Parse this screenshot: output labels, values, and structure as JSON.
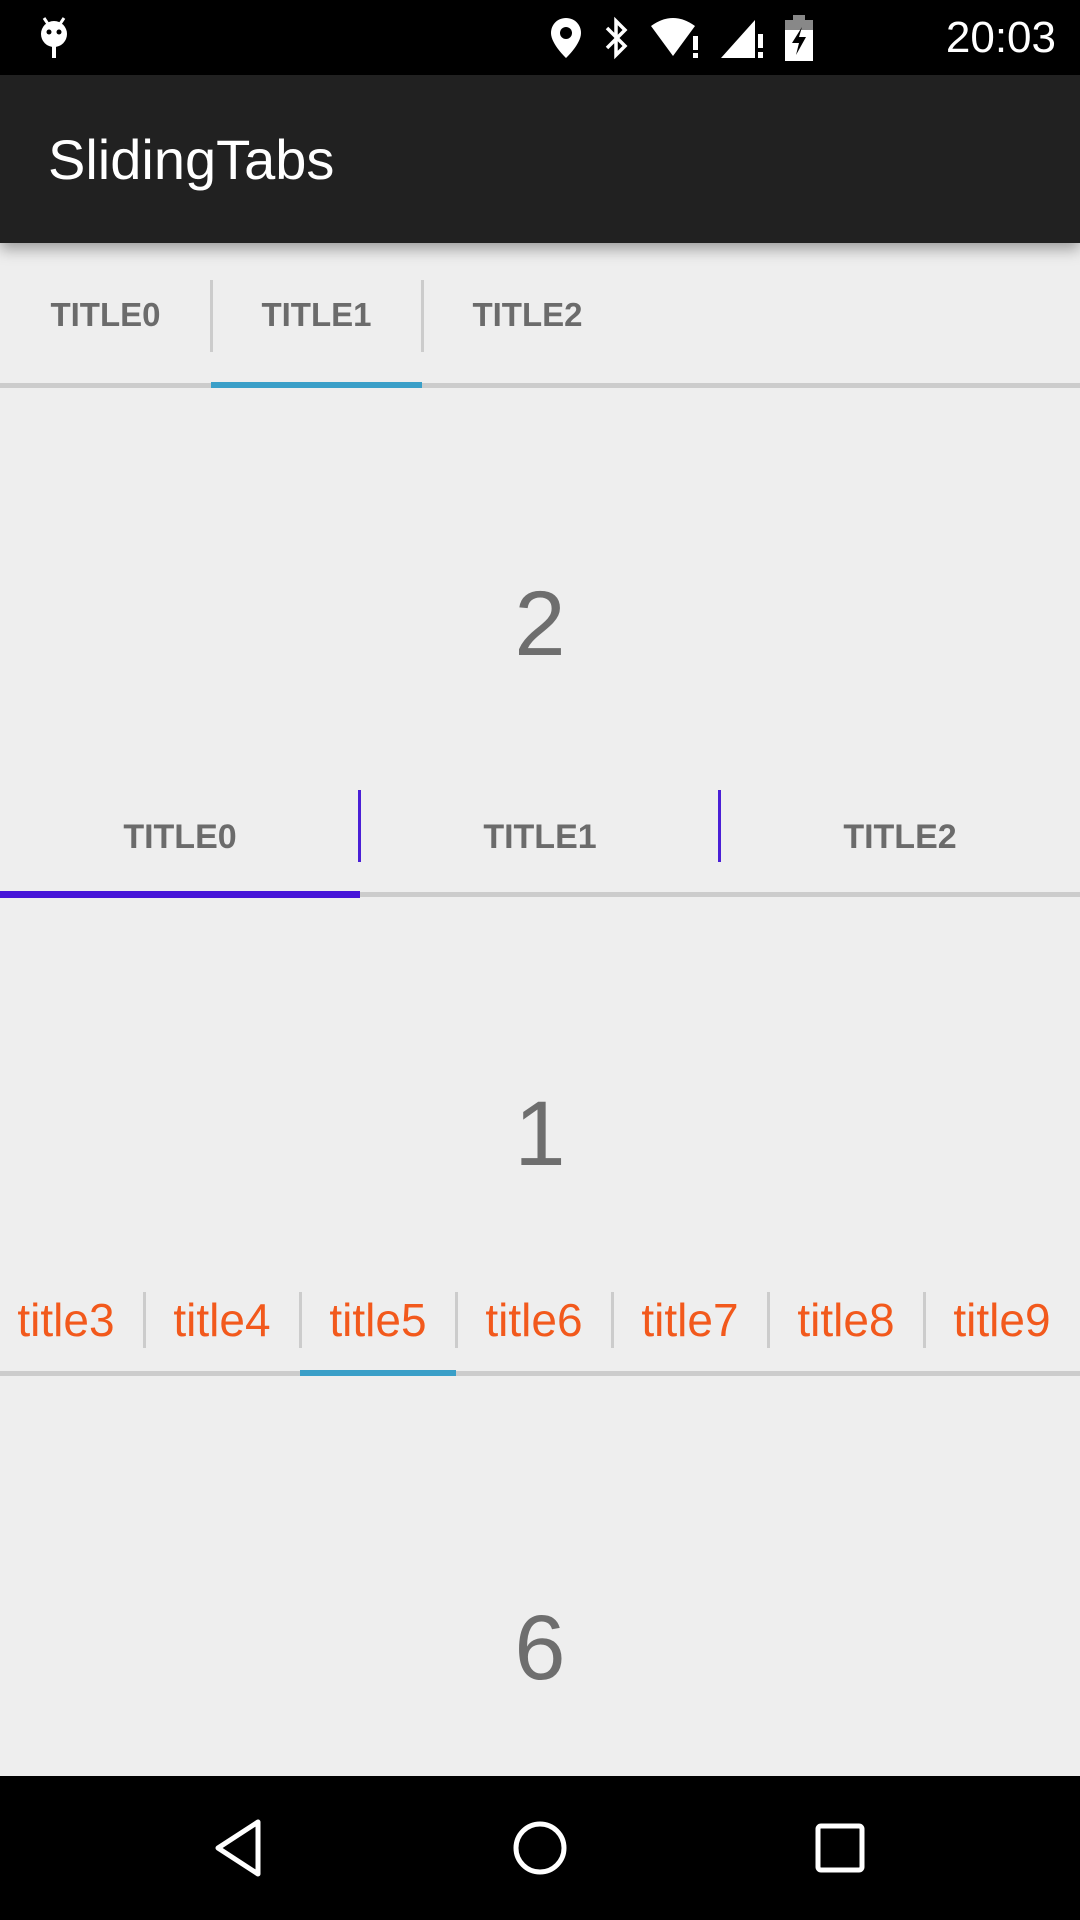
{
  "status_bar": {
    "time": "20:03",
    "icons": [
      "android-debug-icon",
      "location-icon",
      "bluetooth-icon",
      "wifi-alert-icon",
      "signal-alert-icon",
      "battery-charging-icon"
    ]
  },
  "toolbar": {
    "title": "SlidingTabs"
  },
  "tabs_top": {
    "items": [
      "TITLE0",
      "TITLE1",
      "TITLE2"
    ],
    "selected_index": 1,
    "indicator_color": "#3a9fc8",
    "divider_color": "#cccccc"
  },
  "page_top": {
    "number": "2"
  },
  "tabs_middle": {
    "items": [
      "TITLE0",
      "TITLE1",
      "TITLE2"
    ],
    "selected_index": 0,
    "indicator_color": "#4614d8",
    "divider_color": "#4a1fd6"
  },
  "page_middle": {
    "number": "1"
  },
  "tabs_bottom": {
    "items": [
      "title3",
      "title4",
      "title5",
      "title6",
      "title7",
      "title8",
      "title9"
    ],
    "selected_index": 2,
    "text_color": "#f2591c",
    "indicator_color": "#3a9fc8"
  },
  "page_bottom": {
    "number": "6"
  },
  "nav_bar": {
    "buttons": [
      "back-icon",
      "home-icon",
      "recents-icon"
    ]
  }
}
